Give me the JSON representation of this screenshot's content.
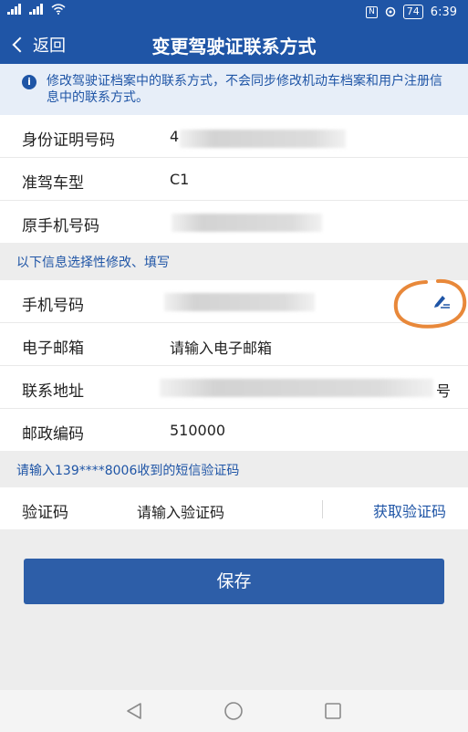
{
  "status_bar": {
    "battery": "74",
    "time": "6:39"
  },
  "nav": {
    "back_label": "返回",
    "title": "变更驾驶证联系方式"
  },
  "notice": {
    "text": "修改驾驶证档案中的联系方式，不会同步修改机动车档案和用户注册信息中的联系方式。"
  },
  "info": {
    "rows": [
      {
        "label": "身份证明号码",
        "value": "4"
      },
      {
        "label": "准驾车型",
        "value": "C1"
      },
      {
        "label": "原手机号码",
        "value": ""
      }
    ]
  },
  "optional_section": {
    "label": "以下信息选择性修改、填写"
  },
  "contact": {
    "phone_label": "手机号码",
    "email_label": "电子邮箱",
    "email_placeholder": "请输入电子邮箱",
    "address_label": "联系地址",
    "address_suffix": "号",
    "postal_label": "邮政编码",
    "postal_value": "510000"
  },
  "sms_section": {
    "label": "请输入139****8006收到的短信验证码"
  },
  "verify": {
    "label": "验证码",
    "placeholder": "请输入验证码",
    "get_code_label": "获取验证码"
  },
  "save_label": "保存",
  "colors": {
    "primary": "#1f55a6",
    "button": "#2d5ea8",
    "annotation": "#e8883a"
  }
}
